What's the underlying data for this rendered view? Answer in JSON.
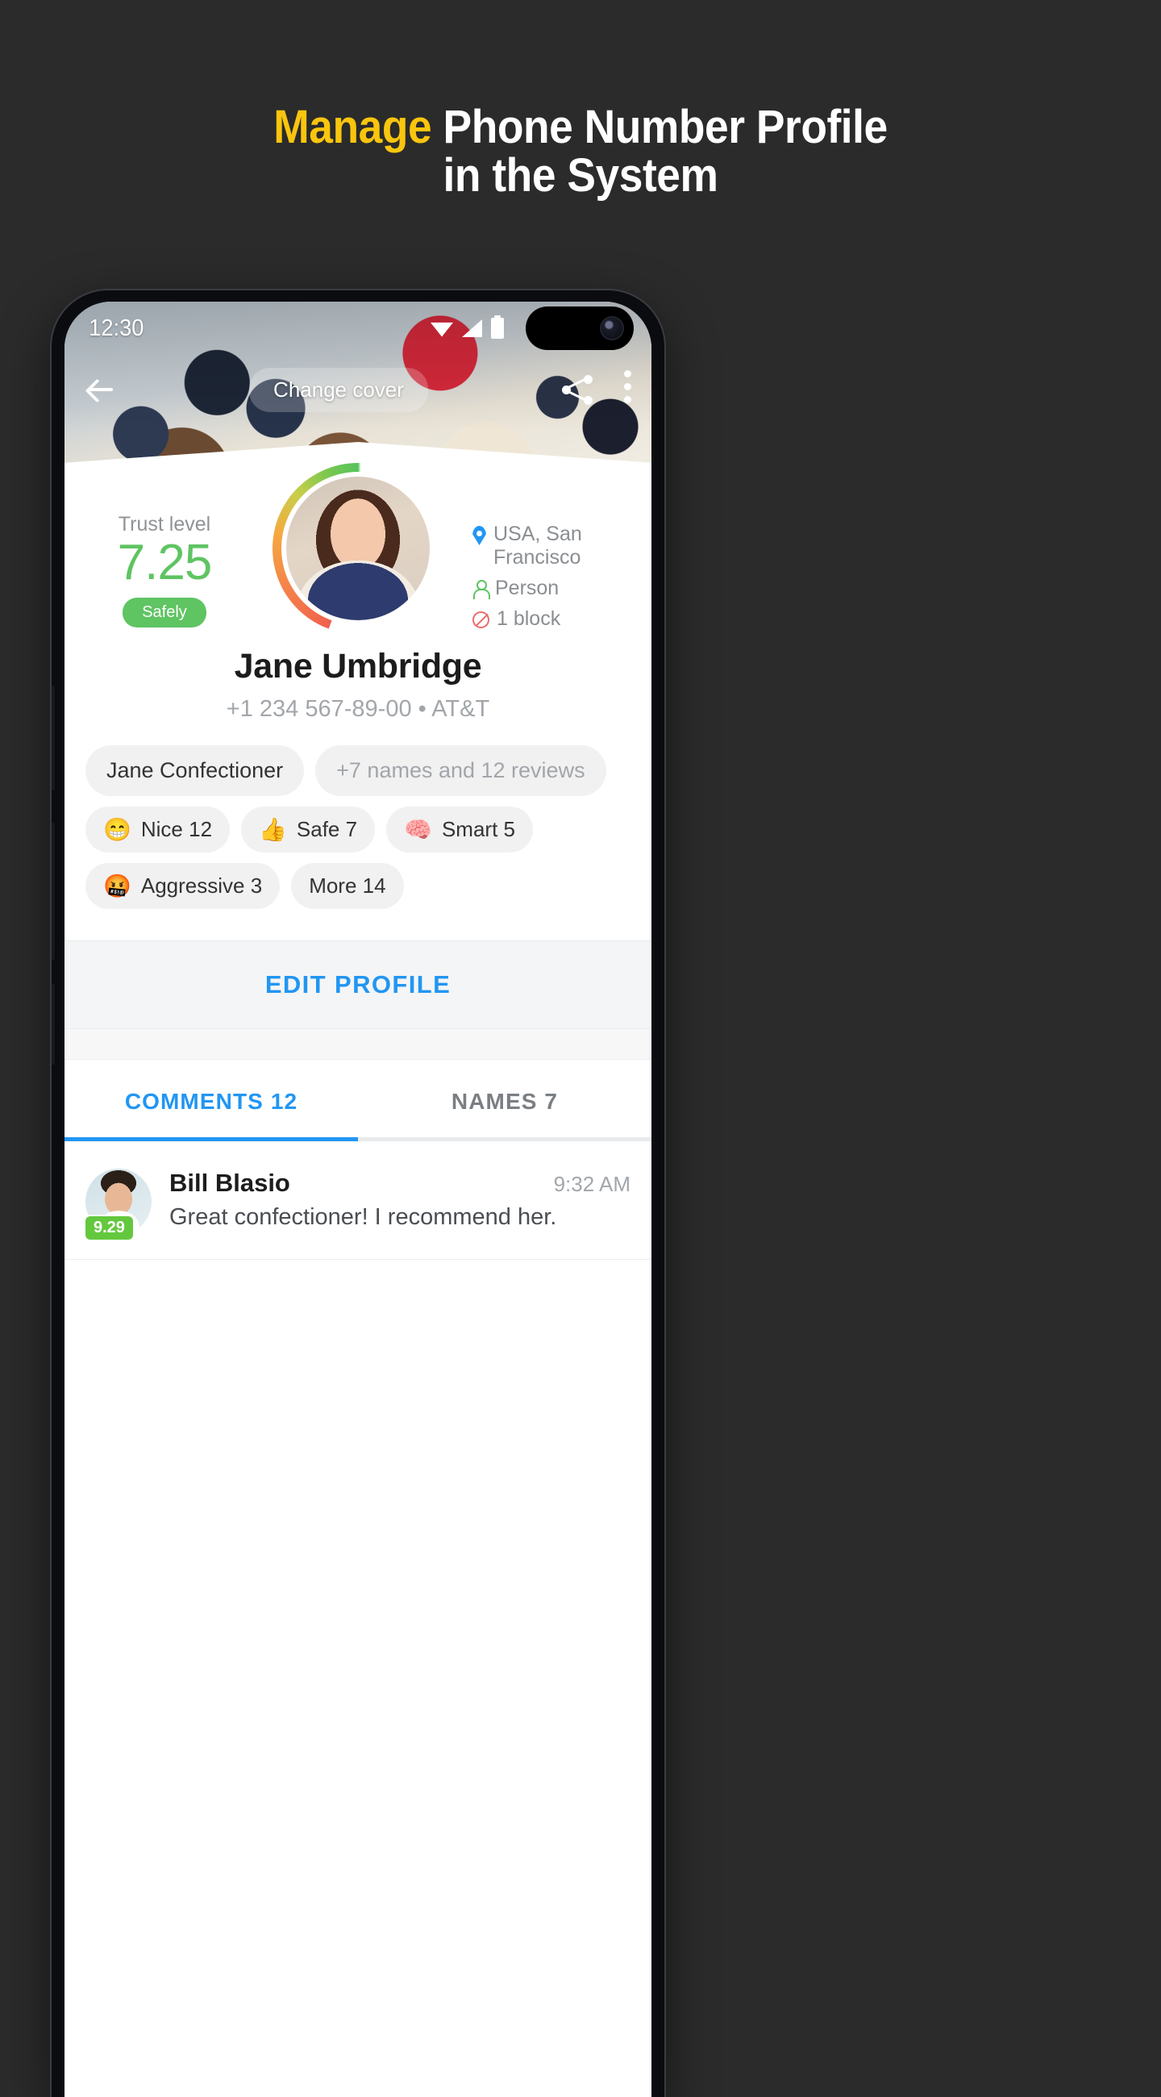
{
  "headline": {
    "accent": "Manage",
    "rest": " Phone Number Profile",
    "line2": "in the System"
  },
  "statusbar": {
    "time": "12:30",
    "icons": [
      "wifi-icon",
      "signal-icon",
      "battery-icon",
      "camera-lens-icon"
    ]
  },
  "cover_bar": {
    "back": "back-arrow-icon",
    "change_cover": "Change cover",
    "share": "share-icon",
    "more": "more-vertical-icon"
  },
  "trust": {
    "label": "Trust level",
    "score": "7.25",
    "badge": "Safely",
    "color": "#5FC462"
  },
  "info": [
    {
      "icon": "location-pin-icon",
      "text": "USA, San Francisco",
      "color": "#2196F3"
    },
    {
      "icon": "person-icon",
      "text": "Person",
      "color": "#5FC462"
    },
    {
      "icon": "block-icon",
      "text": "1 block",
      "color": "#ef6b6b"
    }
  ],
  "profile": {
    "name": "Jane Umbridge",
    "phone": "+1 234 567-89-00 • AT&T"
  },
  "chips_row1": [
    {
      "label": "Jane Confectioner",
      "muted": false
    },
    {
      "label": "+7 names and 12 reviews",
      "muted": true
    }
  ],
  "tags_row1": [
    {
      "emoji": "😁",
      "emoji_name": "grinning-face-emoji",
      "label": "Nice 12"
    },
    {
      "emoji": "👍",
      "emoji_name": "thumbs-up-emoji",
      "label": "Safe 7"
    },
    {
      "emoji": "🧠",
      "emoji_name": "brain-emoji",
      "label": "Smart 5"
    }
  ],
  "tags_row2": [
    {
      "emoji": "🤬",
      "emoji_name": "swearing-face-emoji",
      "label": "Aggressive 3"
    },
    {
      "emoji": "",
      "emoji_name": "",
      "label": "More 14"
    }
  ],
  "edit": {
    "label": "EDIT PROFILE",
    "color": "#2196F3"
  },
  "tabs": [
    {
      "label": "COMMENTS 12",
      "active": true
    },
    {
      "label": "NAMES 7",
      "active": false
    }
  ],
  "comments": [
    {
      "author": "Bill Blasio",
      "score": "9.29",
      "time": "9:32 AM",
      "text": "Great confectioner! I recommend her."
    }
  ]
}
